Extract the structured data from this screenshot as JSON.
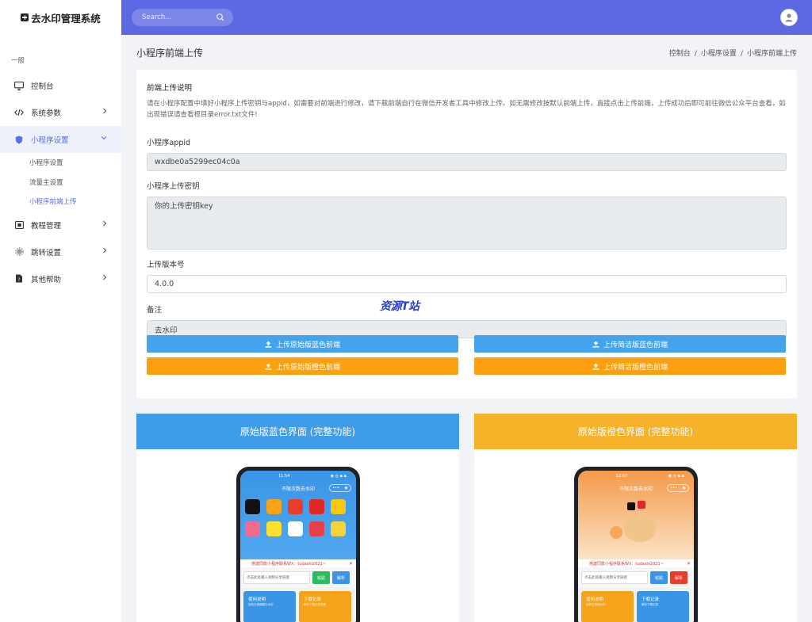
{
  "app": {
    "brand": "去水印管理系统"
  },
  "sidebar": {
    "section": "一般",
    "items": [
      {
        "label": "控制台",
        "icon": "monitor-icon"
      },
      {
        "label": "系统参数",
        "icon": "code-icon"
      },
      {
        "label": "小程序设置",
        "icon": "shield-icon"
      },
      {
        "label": "教程管理",
        "icon": "tutorial-icon"
      },
      {
        "label": "跳转设置",
        "icon": "gear-icon"
      },
      {
        "label": "其他帮助",
        "icon": "help-doc-icon"
      }
    ],
    "submenu": [
      "小程序设置",
      "流量主设置",
      "小程序前端上传"
    ]
  },
  "topbar": {
    "search_placeholder": "Search..."
  },
  "page": {
    "title": "小程序前端上传",
    "breadcrumb": [
      "控制台",
      "小程序设置",
      "小程序前端上传"
    ]
  },
  "form": {
    "intro_title": "前端上传说明",
    "intro_text": "请在小程序配置中填好小程序上传密钥与appid，如需要对前端进行修改，请下载前端自行在微信开发者工具中修改上传。如无需修改按默认前端上传，直接点击上传前端，上传成功后即可前往微信公众平台查看，如出现错误请查看根目录error.txt文件!",
    "appid_label": "小程序appid",
    "appid_value": "wxdbe0a5299ec04c0a",
    "key_label": "小程序上传密钥",
    "key_value": "你的上传密钥key",
    "version_label": "上传版本号",
    "version_value": "4.0.0",
    "remark_label": "备注",
    "remark_value": "去水印",
    "buttons": {
      "orig_blue": "上传原始版蓝色前端",
      "simple_blue": "上传简洁版蓝色前端",
      "orig_orange": "上传原始版橙色前端",
      "simple_orange": "上传简洁版橙色前端"
    }
  },
  "watermark": "资源T站",
  "previews": [
    {
      "title": "原始版蓝色界面 (完整功能)",
      "color": "#3f9ce8",
      "time": "11:54",
      "app_title": "不限次数去水印",
      "notice": "搭建同款小程序联系WX：tudashi2021~",
      "input_placeholder": "点击此处输入视频分享链接",
      "paste": "粘贴",
      "parse": "解析",
      "card1_title": "使用说明",
      "card1_sub": "如何去视频图片水印",
      "card2_title": "下载记录",
      "card2_sub": "解析下载记录查看"
    },
    {
      "title": "原始版橙色界面 (完整功能)",
      "color": "#f6b228",
      "time": "12:07",
      "app_title": "不限次数去水印",
      "notice": "搭建同款小程序联系WX：tudashi2021~",
      "input_placeholder": "点击此处输入视频分享链接",
      "paste": "粘贴",
      "parse": "解析",
      "card1_title": "使用说明",
      "card1_sub": "如何去视频水印",
      "card2_title": "下载记录",
      "card2_sub": "解析下载记录"
    }
  ]
}
